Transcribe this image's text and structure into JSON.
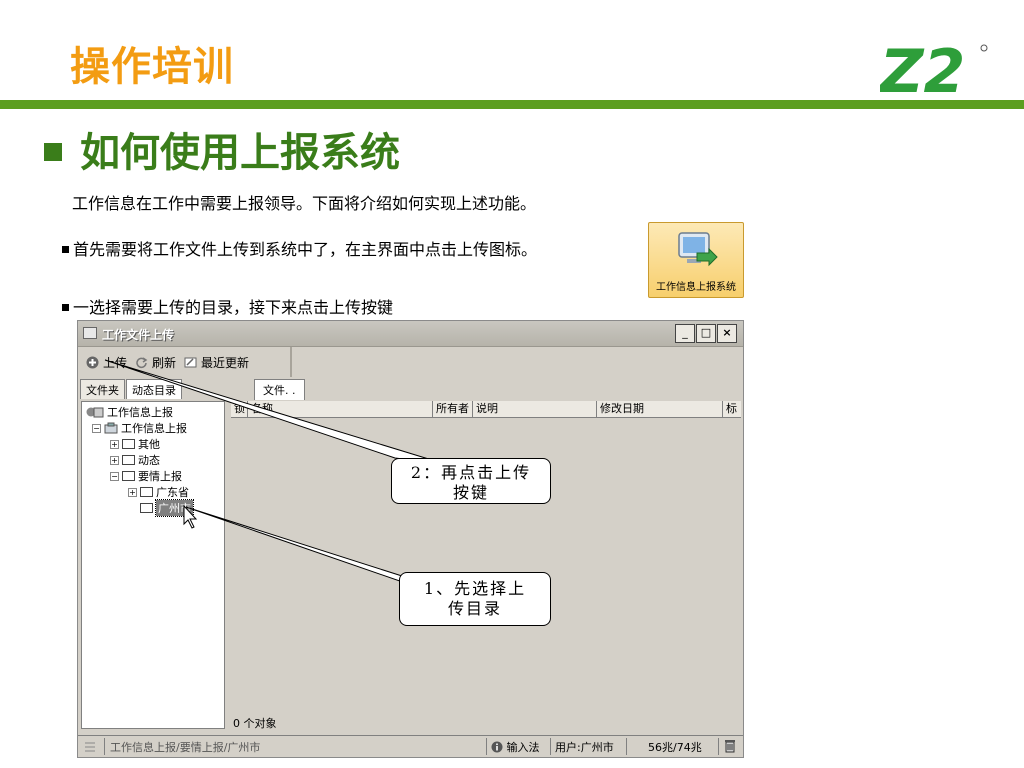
{
  "slide": {
    "title": "操作培训",
    "logo_text": "Z2",
    "heading": "如何使用上报系统",
    "paragraph": "工作信息在工作中需要上报领导。下面将介绍如何实现上述功能。",
    "bullet1": "首先需要将工作文件上传到系统中了，在主界面中点击上传图标。",
    "bullet2": "一选择需要上传的目录，接下来点击上传按键",
    "app_icon_label": "工作信息上报系统",
    "colors": {
      "title": "#f39c12",
      "green": "#3a7d1a",
      "bar": "#5c9e1f"
    }
  },
  "window": {
    "title": "工作文件上传",
    "controls": {
      "minimize": "_",
      "maximize": "□",
      "close": "×"
    },
    "toolbar": {
      "upload": "上传",
      "refresh": "刷新",
      "recent": "最近更新"
    },
    "tabs": [
      "文件夹",
      "动态目录"
    ],
    "file_tab": "文件. .",
    "tree": {
      "root": "工作信息上报",
      "child": "工作信息上报",
      "items": [
        "其他",
        "动态",
        "要情上报",
        "广东省",
        "广州市"
      ]
    },
    "columns": [
      "锁",
      "名称",
      "所有者",
      "说明",
      "修改日期",
      "标"
    ],
    "object_count": "0 个对象",
    "status": {
      "path": "工作信息上报/要情上报/广州市",
      "ime": "输入法",
      "user": "用户:广州市",
      "storage": "56兆/74兆"
    }
  },
  "callouts": {
    "step2_line1": "2：再点击上传",
    "step2_line2": "按键",
    "step1_line1": "1、先选择上",
    "step1_line2": "传目录"
  }
}
